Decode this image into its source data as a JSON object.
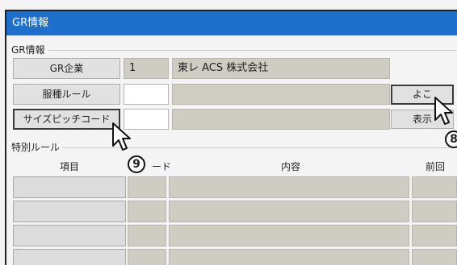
{
  "window": {
    "title": "GR情報"
  },
  "gr_group": {
    "label": "GR情報",
    "company": {
      "label": "GR企業",
      "code": "1",
      "name": "東レ ACS 株式会社"
    },
    "rule": {
      "label": "服種ルール",
      "button": "よこ"
    },
    "size_pitch": {
      "label": "サイズピッチコード",
      "button": "表示"
    }
  },
  "special_rules": {
    "label": "特別ルール",
    "columns": {
      "item": "項目",
      "code": "ード",
      "content": "内容",
      "prev": "前回"
    }
  },
  "markers": {
    "eight": "8",
    "nine": "9"
  }
}
